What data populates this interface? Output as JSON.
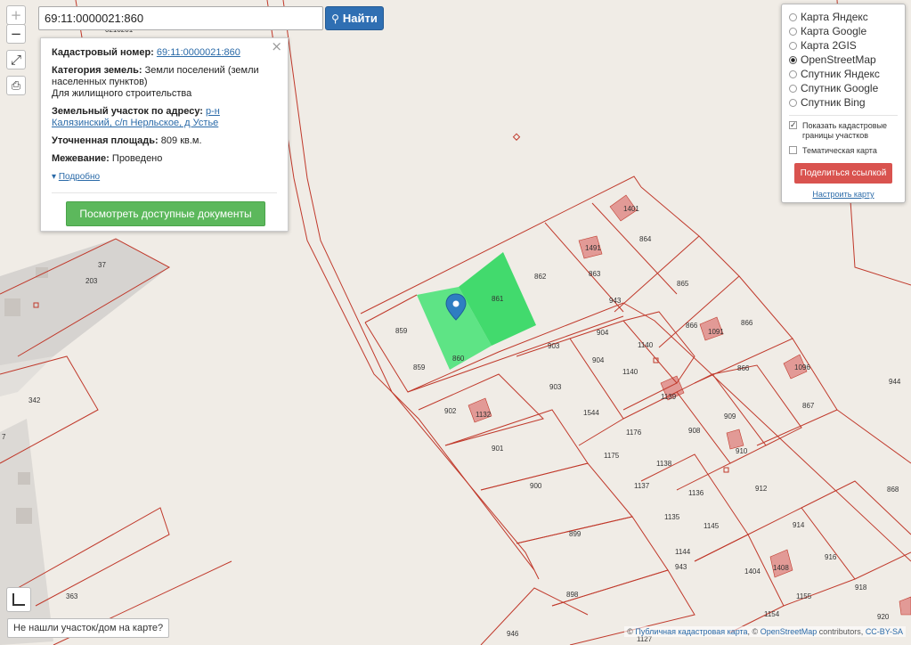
{
  "search": {
    "value": "69:11:0000021:860",
    "button_label": "Найти"
  },
  "controls": {
    "zoom_in": "+",
    "zoom_out": "−"
  },
  "popup": {
    "cadastral_label": "Кадастровый номер:",
    "cadastral_value": "69:11:0000021:860",
    "category_label": "Категория земель:",
    "category_value": "Земли поселений (земли населенных пунктов)",
    "category_value2": "Для жилищного строительства",
    "address_label": "Земельный участок по адресу:",
    "address_value": "р-н Калязинский, с/п Нерльское, д Устье",
    "area_label": "Уточненная площадь:",
    "area_value": "809 кв.м.",
    "survey_label": "Межевание:",
    "survey_value": "Проведено",
    "more_label": "Подробно",
    "docs_button": "Посмотреть доступные документы",
    "close": "×"
  },
  "layers": {
    "options": [
      "Карта Яндекс",
      "Карта Google",
      "Карта 2GIS",
      "OpenStreetMap",
      "Спутник Яндекс",
      "Спутник Google",
      "Спутник Bing"
    ],
    "selected": "OpenStreetMap",
    "show_boundaries": "Показать кадастровые границы участков",
    "thematic": "Тематическая карта",
    "share_button": "Поделиться ссылкой",
    "configure_link": "Настроить карту"
  },
  "not_found_button": "Не нашли участок/дом на карте?",
  "attribution": {
    "prefix": "©",
    "link1": "Публичная кадастровая карта",
    "sep": ", ©",
    "link2": "OpenStreetMap",
    "mid": "contributors,",
    "link3": "CC-BY-SA"
  },
  "map": {
    "colors": {
      "boundary": "#c0392b",
      "highlight": "#3ee06a",
      "building": "#e28a8a",
      "road": "#d9d9d9"
    },
    "parcel_labels": [
      "0210201",
      "37",
      "203",
      "342",
      "7",
      "363",
      "859",
      "859",
      "860",
      "861",
      "862",
      "863",
      "864",
      "865",
      "866",
      "866",
      "867",
      "868",
      "902",
      "901",
      "900",
      "899",
      "898",
      "903",
      "903",
      "904",
      "904",
      "943",
      "943",
      "1140",
      "1140",
      "1139",
      "1544",
      "1176",
      "1175",
      "1138",
      "1137",
      "1136",
      "1135",
      "1145",
      "1144",
      "908",
      "909",
      "910",
      "912",
      "914",
      "916",
      "918",
      "920",
      "944",
      "1404",
      "1155",
      "1154",
      "1401",
      "1491",
      "1091",
      "1096",
      "1132",
      "1408",
      "946",
      "1127"
    ]
  }
}
